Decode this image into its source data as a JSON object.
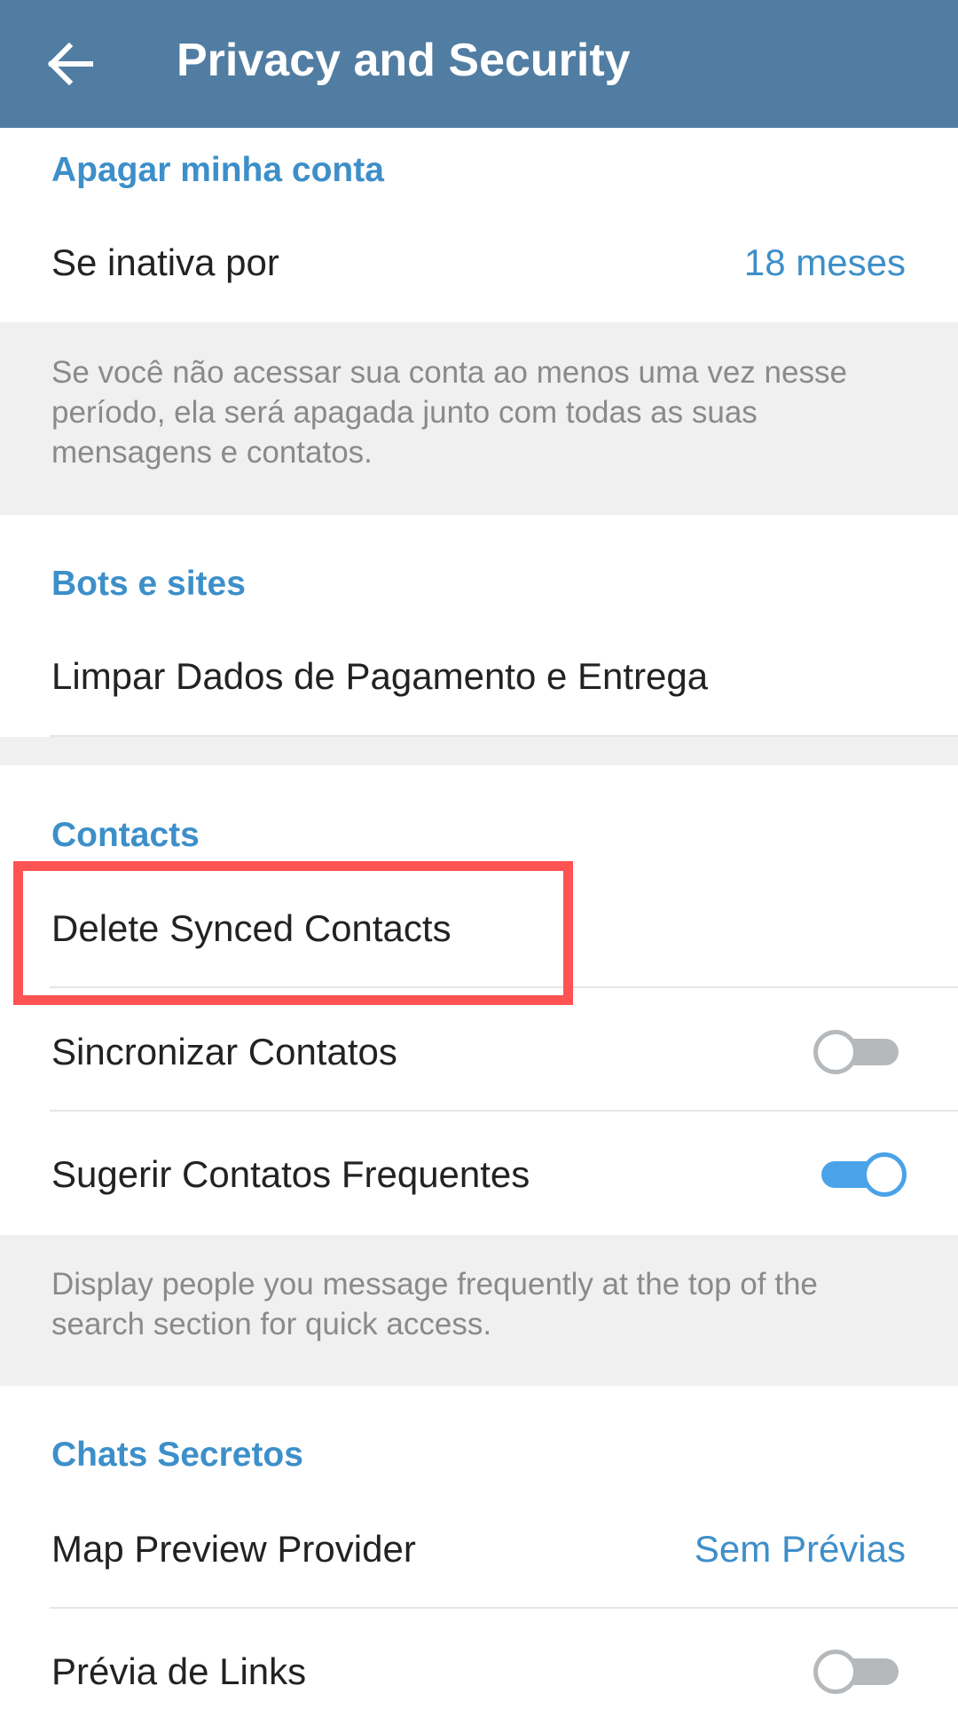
{
  "header": {
    "title": "Privacy and Security"
  },
  "sections": {
    "delete_account": {
      "title": "Apagar minha conta",
      "row_label": "Se inativa por",
      "row_value": "18 meses",
      "info": "Se você não acessar sua conta ao menos uma vez nesse período, ela será apagada junto com todas as suas mensagens e contatos."
    },
    "bots": {
      "title": "Bots e sites",
      "row_label": "Limpar Dados de Pagamento e Entrega"
    },
    "contacts": {
      "title": "Contacts",
      "delete_synced": "Delete Synced Contacts",
      "sync_label": "Sincronizar Contatos",
      "sync_on": false,
      "suggest_label": "Sugerir Contatos Frequentes",
      "suggest_on": true,
      "info": "Display people you message frequently at the top of the search section for quick access."
    },
    "secret_chats": {
      "title": "Chats Secretos",
      "map_label": "Map Preview Provider",
      "map_value": "Sem Prévias",
      "link_label": "Prévia de Links",
      "link_on": false
    }
  },
  "colors": {
    "header": "#517DA2",
    "accent": "#3D8FC9",
    "highlight": "#FF5252",
    "toggle_on": "#4aa3e8"
  }
}
